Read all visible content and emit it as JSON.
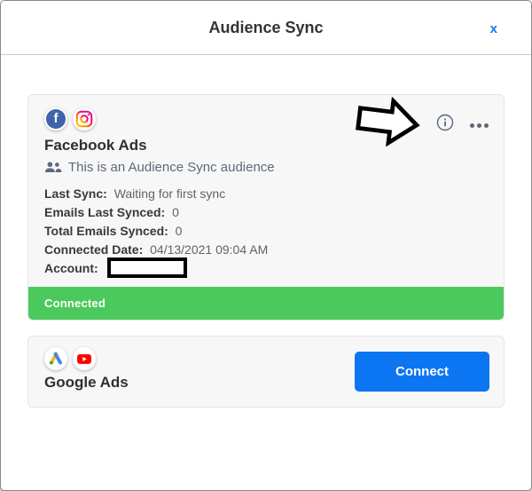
{
  "modal": {
    "title": "Audience Sync",
    "close_label": "x"
  },
  "facebook_card": {
    "title": "Facebook Ads",
    "description": "This is an Audience Sync audience",
    "details": [
      {
        "label": "Last Sync:",
        "value": "Waiting for first sync"
      },
      {
        "label": "Emails Last Synced:",
        "value": "0"
      },
      {
        "label": "Total Emails Synced:",
        "value": "0"
      },
      {
        "label": "Connected Date:",
        "value": "04/13/2021 09:04 AM"
      },
      {
        "label": "Account:",
        "value": "",
        "redacted": true
      }
    ],
    "status": "Connected"
  },
  "google_card": {
    "title": "Google Ads",
    "connect_label": "Connect"
  },
  "icons": {
    "facebook_glyph": "f",
    "info": "info-circle",
    "more": "horizontal-ellipsis",
    "annotation": "block-arrow-pointing-right"
  },
  "colors": {
    "status_green": "#4cc95c",
    "connect_blue": "#0c76f2",
    "facebook_blue": "#4064ac",
    "close_blue": "#1877f2",
    "youtube_red": "#ff0000",
    "gads_yellow": "#fbbc04",
    "gads_blue": "#4285f4",
    "gads_green": "#34a853"
  }
}
